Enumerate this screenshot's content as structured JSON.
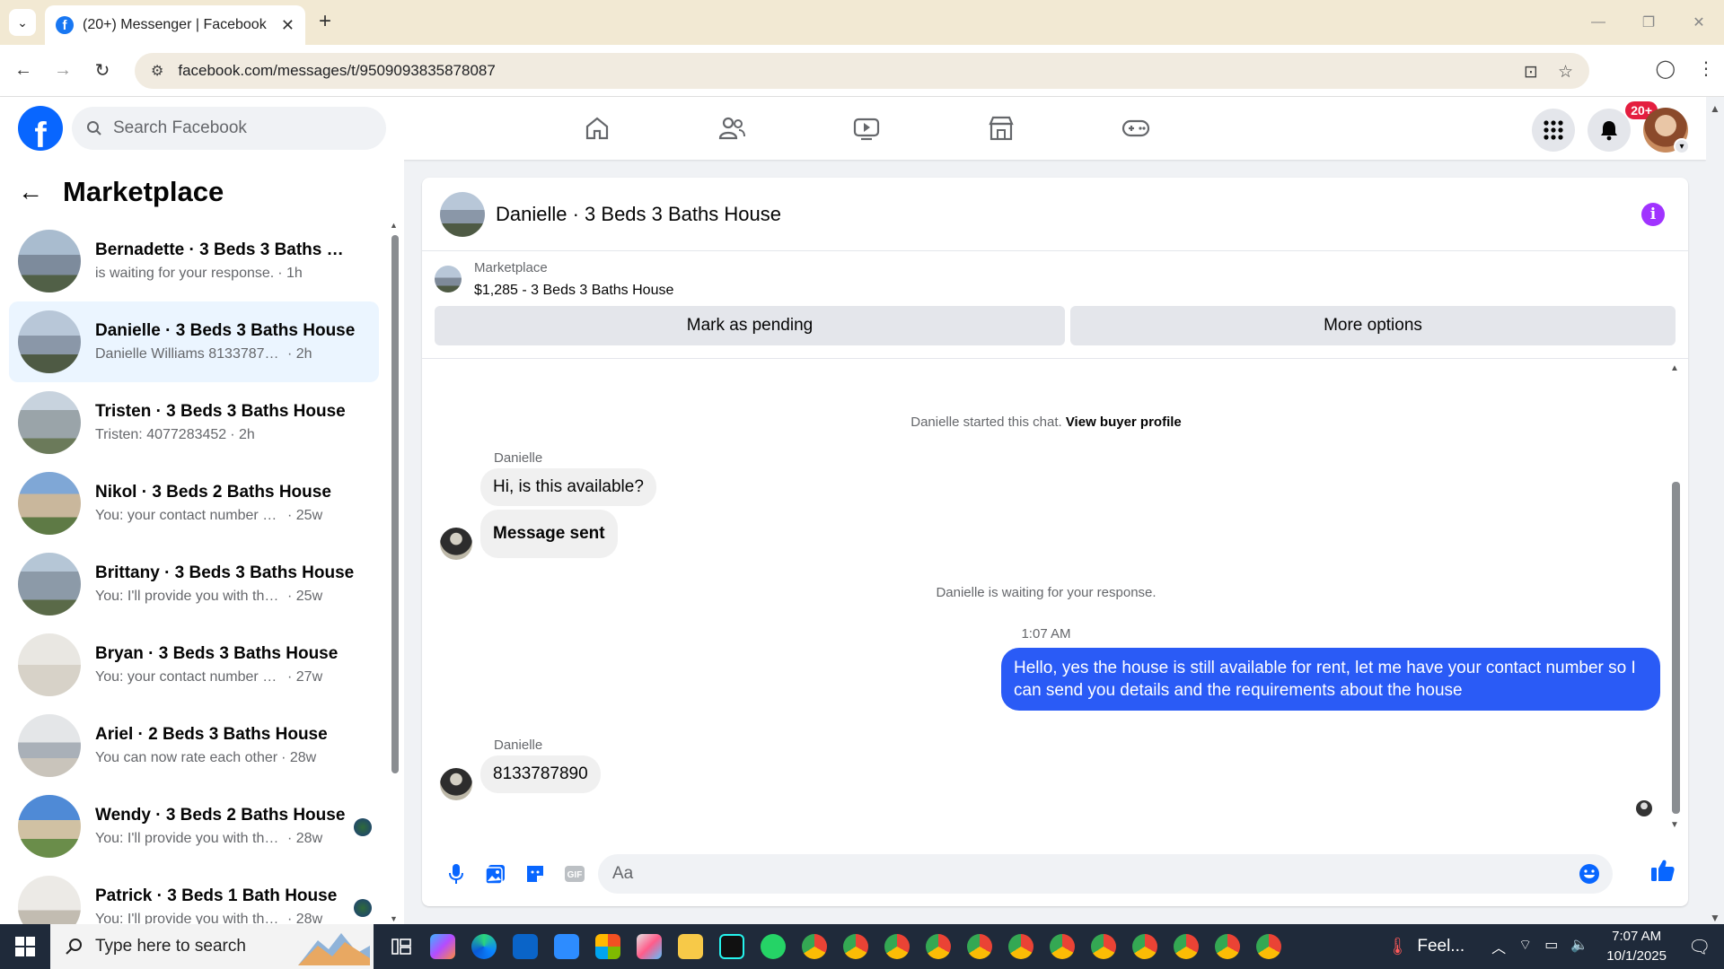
{
  "browser": {
    "tab_title": "(20+) Messenger | Facebook",
    "url": "facebook.com/messages/t/9509093835878087"
  },
  "fb": {
    "search_placeholder": "Search Facebook",
    "notification_badge": "20+",
    "brand_color": "#0866ff"
  },
  "sidebar": {
    "title": "Marketplace",
    "conversations": [
      {
        "name": "Bernadette · 3 Beds 3 Baths Hou...",
        "preview": "is waiting for your response.",
        "time": "· 1h",
        "active": false
      },
      {
        "name": "Danielle · 3 Beds 3 Baths House",
        "preview": "Danielle Williams 8133787890",
        "time": "· 2h",
        "active": true
      },
      {
        "name": "Tristen · 3 Beds 3 Baths House",
        "preview": "Tristen: 4077283452",
        "time": "· 2h",
        "active": false
      },
      {
        "name": "Nikol · 3 Beds 2 Baths House",
        "preview": "You: your contact number so I ca...",
        "time": "· 25w",
        "active": false
      },
      {
        "name": "Brittany · 3 Beds 3 Baths House",
        "preview": "You: I'll provide you with the addi...",
        "time": "· 25w",
        "active": false
      },
      {
        "name": "Bryan · 3 Beds 3 Baths House",
        "preview": "You: your contact number so I ca...",
        "time": "· 27w",
        "active": false
      },
      {
        "name": "Ariel · 2 Beds 3 Baths House",
        "preview": "You can now rate each other",
        "time": "· 28w",
        "active": false
      },
      {
        "name": "Wendy · 3 Beds 2 Baths House",
        "preview": "You: I'll provide you with the a...",
        "time": "· 28w",
        "active": false
      },
      {
        "name": "Patrick · 3 Beds 1 Bath House",
        "preview": "You: I'll provide you with the a...",
        "time": "· 28w",
        "active": false
      }
    ]
  },
  "chat": {
    "title": "Danielle · 3 Beds 3 Baths House",
    "listing_label": "Marketplace",
    "listing_price": "$1,285 - 3 Beds 3 Baths House",
    "mark_pending": "Mark as pending",
    "more_options": "More options",
    "started_text": "Danielle started this chat.",
    "view_profile": "View buyer profile",
    "sender1": "Danielle",
    "msg1": "Hi, is this available?",
    "msg2": "Message sent",
    "waiting": "Danielle is waiting for your response.",
    "timestamp": "1:07 AM",
    "outgoing": "Hello, yes the house is still available for rent, let me have your contact number so I can send you details and the requirements about the house",
    "sender2": "Danielle",
    "msg3": "8133787890",
    "composer_placeholder": "Aa",
    "outgoing_color": "#2a5bf6"
  },
  "taskbar": {
    "search_placeholder": "Type here to search",
    "weather": "Feel...",
    "time": "7:07 AM",
    "date": "10/1/2025"
  }
}
